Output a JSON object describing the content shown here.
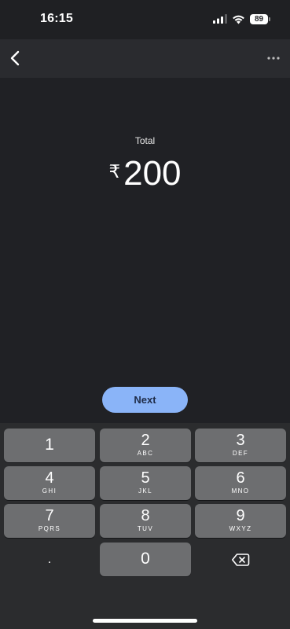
{
  "status_bar": {
    "time": "16:15",
    "battery_level": "89"
  },
  "app_bar": {
    "back_icon": "chevron-left-icon",
    "more_icon": "more-horizontal-icon"
  },
  "payment": {
    "total_label": "Total",
    "currency_symbol": "₹",
    "amount": "200"
  },
  "next_button": {
    "label": "Next",
    "color": "#8ab4f8"
  },
  "keypad": {
    "keys": [
      {
        "digit": "1",
        "letters": ""
      },
      {
        "digit": "2",
        "letters": "ABC"
      },
      {
        "digit": "3",
        "letters": "DEF"
      },
      {
        "digit": "4",
        "letters": "GHI"
      },
      {
        "digit": "5",
        "letters": "JKL"
      },
      {
        "digit": "6",
        "letters": "MNO"
      },
      {
        "digit": "7",
        "letters": "PQRS"
      },
      {
        "digit": "8",
        "letters": "TUV"
      },
      {
        "digit": "9",
        "letters": "WXYZ"
      },
      {
        "digit": "0",
        "letters": ""
      }
    ],
    "decimal_key": ".",
    "backspace_icon": "backspace-icon"
  },
  "colors": {
    "background": "#202125",
    "app_bar": "#2a2b2f",
    "keypad_background": "#2b2c2e",
    "key": "#6d6e70"
  }
}
